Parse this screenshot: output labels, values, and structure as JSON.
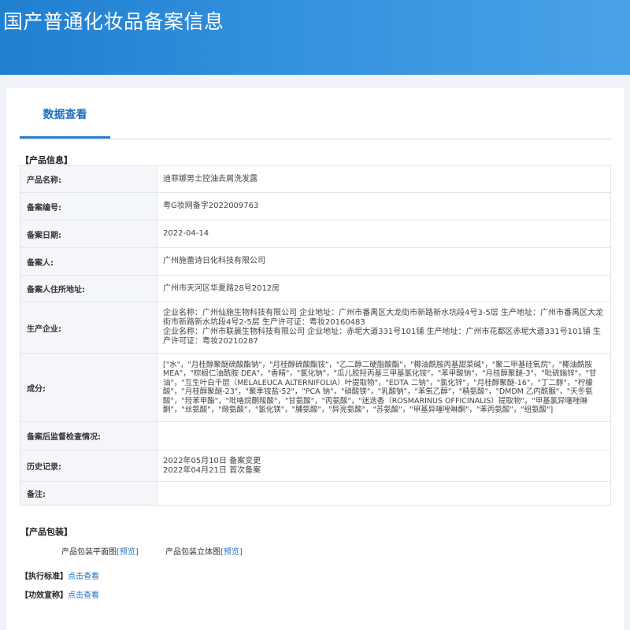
{
  "page": {
    "title": "国产普通化妆品备案信息"
  },
  "tabs": [
    {
      "label": "数据查看"
    }
  ],
  "sections": {
    "product_info": "【产品信息】",
    "product_package": "【产品包装】",
    "standard": "【执行标准】",
    "efficacy": "【功效宣称】"
  },
  "rows": {
    "name": {
      "label": "产品名称:",
      "value": "迪菲娜男士控油去屑洗发露"
    },
    "record_no": {
      "label": "备案编号:",
      "value": "粤G妆网备字2022009763"
    },
    "record_date": {
      "label": "备案日期:",
      "value": "2022-04-14"
    },
    "filer": {
      "label": "备案人:",
      "value": "广州施蕾诗日化科技有限公司"
    },
    "filer_address": {
      "label": "备案人住所地址:",
      "value": "广州市天河区华夏路28号2012房"
    },
    "manufacturer": {
      "label": "生产企业:",
      "line1": "企业名称：广州仙施生物科技有限公司 企业地址：广州市番禺区大龙街市新路新水坑段4号3-5层 生产地址：广州市番禺区大龙街市新路新水坑段4号2-5层 生产许可证：粤妆20160483",
      "line2": "企业名称：广州市联晨生物科技有限公司 企业地址：赤坭大道331号101铺 生产地址：广州市花都区赤坭大道331号101铺 生产许可证：粤妆20210287"
    },
    "ingredients": {
      "label": "成分:",
      "value": "[\"水\"，\"月桂醇聚醚硫酸酯钠\"，\"月桂醇硫酸酯铵\"，\"乙二醇二硬脂酸酯\"，\"椰油酰胺丙基甜菜碱\"，\"聚二甲基硅氧烷\"，\"椰油酰胺 MEA\"，\"棕榈仁油酰胺 DEA\"，\"香精\"，\"氯化钠\"，\"瓜儿胶羟丙基三甲基氯化铵\"，\"苯甲酸钠\"，\"月桂醇聚醚-3\"，\"吡硫鎓锌\"，\"甘油\"，\"互生叶白千层（MELALEUCA ALTERNIFOLIA）叶提取物\"，\"EDTA 二钠\"，\"氯化锌\"，\"月桂醇聚醚-16\"，\"丁二醇\"，\"柠檬酸\"，\"月桂醇聚醚-23\"，\"聚季铵盐-52\"，\"PCA 钠\"，\"硝酸镁\"，\"乳酸钠\"，\"苯氧乙醇\"，\"精氨酸\"，\"DMDM 乙内酰脲\"，\"天冬氨酸\"，\"羟苯甲酯\"，\"吡咯烷酮羧酸\"，\"甘氨酸\"，\"丙氨酸\"，\"迷迭香（ROSMARINUS OFFICINALIS）提取物\"，\"甲基氯异噻唑啉酮\"，\"丝氨酸\"，\"缬氨酸\"，\"氯化镁\"，\"脯氨酸\"，\"异亮氨酸\"，\"苏氨酸\"，\"甲基异噻唑啉酮\"，\"苯丙氨酸\"，\"组氨酸\"]"
    },
    "inspection": {
      "label": "备案后监督检查情况:",
      "value": ""
    },
    "history": {
      "label": "历史记录:",
      "line1": "2022年05月10日 备案变更",
      "line2": "2022年04月21日 首次备案"
    },
    "remark": {
      "label": "备注:",
      "value": ""
    }
  },
  "packaging": {
    "flat_label": "产品包装平面图",
    "flat_link": "[预览]",
    "solid_label": "产品包装立体图",
    "solid_link": "[预览]"
  },
  "links": {
    "standard_view": "点击查看",
    "efficacy_view": "点击查看"
  }
}
